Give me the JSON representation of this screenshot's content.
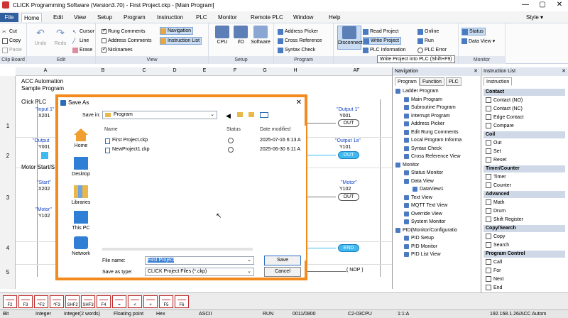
{
  "window": {
    "title": "CLICK Programming Software (Version3.70) - First Project.ckp - [Main Program]",
    "minimize": "—",
    "maximize": "▢",
    "close": "✕"
  },
  "menu": {
    "items": [
      "File",
      "Home",
      "Edit",
      "View",
      "Setup",
      "Program",
      "Instruction",
      "PLC",
      "Monitor",
      "Remote PLC",
      "Window",
      "Help"
    ],
    "style": "Style ▾"
  },
  "ribbon": {
    "clipboard": {
      "cut": "Cut",
      "copy": "Copy",
      "paste": "Paste",
      "label": "Clip Board"
    },
    "edit": {
      "undo": "Undo",
      "redo": "Redo",
      "cursor": "Cursor",
      "line": "Line",
      "erase": "Erase",
      "label": "Edit"
    },
    "view": {
      "rung_comments": "Rung Comments",
      "address_comments": "Address Comments",
      "nicknames": "Nicknames",
      "navigation": "Navigation",
      "instruction_list": "Instruction List",
      "label": "View"
    },
    "setup": {
      "cpu": "CPU",
      "io": "I/O",
      "software": "Software",
      "label": "Setup"
    },
    "program": {
      "address_picker": "Address Picker",
      "cross_reference": "Cross Reference",
      "syntax_check": "Syntax Check",
      "label": "Program"
    },
    "plc": {
      "disconnect": "Disconnect",
      "read_project": "Read Project",
      "write_project": "Write Project",
      "plc_information": "PLC Information",
      "online": "Online",
      "run": "Run",
      "plc_error": "PLC Error",
      "label": "PLC"
    },
    "monitor": {
      "status": "Status",
      "data_view": "Data View ▾",
      "label": "Monitor"
    }
  },
  "tooltip": "Write Project into PLC (Shift+F9)",
  "ladder": {
    "columns": [
      "A",
      "B",
      "C",
      "D",
      "E",
      "F",
      "G",
      "H",
      "AF"
    ],
    "rows": [
      "1",
      "2",
      "3",
      "4",
      "5"
    ],
    "comments": [
      "ACC Automation",
      "Sample Program",
      "Click PLC",
      "Motor Start/S"
    ],
    "contacts": [
      {
        "name": "\"Input 1\"",
        "addr": "X201"
      },
      {
        "name": "\"Output",
        "addr": "Y001"
      },
      {
        "name": "\"Start\"",
        "addr": "X202"
      },
      {
        "name": "\"Motor\"",
        "addr": "Y102"
      }
    ],
    "coils": [
      {
        "name": "\"Output 1\"",
        "addr": "Y001",
        "label": "OUT"
      },
      {
        "name": "\"Output 1a\"",
        "addr": "Y101",
        "label": "OUT"
      },
      {
        "name": "\"Motor\"",
        "addr": "Y102",
        "label": "OUT"
      }
    ],
    "end": "END",
    "nop": "NOP"
  },
  "dialog": {
    "title": "Save As",
    "save_in_label": "Save in:",
    "save_in_value": "Program",
    "nav": [
      "Home",
      "Desktop",
      "Libraries",
      "This PC",
      "Network"
    ],
    "headers": {
      "name": "Name",
      "status": "Status",
      "date": "Date modified"
    },
    "files": [
      {
        "name": "First Project.ckp",
        "date": "2025-07-16 6:13 A"
      },
      {
        "name": "NewProject1.ckp",
        "date": "2025-06-30 6:11 A"
      }
    ],
    "file_name_label": "File name:",
    "file_name_value": "First Project",
    "save_type_label": "Save as type:",
    "save_type_value": "CLICK Project Files (*.ckp)",
    "save_button": "Save",
    "cancel_button": "Cancel"
  },
  "navigation": {
    "title": "Navigation",
    "tabs": [
      "Program",
      "Function",
      "PLC"
    ],
    "tree": [
      "Ladder Program",
      "Main Program",
      "Subroutine Program",
      "Interrupt Program",
      "Address Picker",
      "Edit Rung Comments",
      "Local Program Informa",
      "Syntax Check",
      "Cross Reference View",
      "Monitor",
      "Status Monitor",
      "Data View",
      "DataView1",
      "Text View",
      "MQTT Text View",
      "Override View",
      "System Monitor",
      "PID(Monitor/Configuratio",
      "PID Setup",
      "PID Monitor",
      "PID List View"
    ]
  },
  "instruction_list": {
    "title": "Instruction List",
    "tab": "Instruction",
    "sections": [
      {
        "name": "Contact",
        "items": [
          "Contact (NO)",
          "Contact (NC)",
          "Edge Contact",
          "Compare"
        ]
      },
      {
        "name": "Coil",
        "items": [
          "Out",
          "Set",
          "Reset"
        ]
      },
      {
        "name": "Timer/Counter",
        "items": [
          "Timer",
          "Counter"
        ]
      },
      {
        "name": "Advanced",
        "items": [
          "Math",
          "Drum",
          "Shift Register"
        ]
      },
      {
        "name": "Copy/Search",
        "items": [
          "Copy",
          "Search"
        ]
      },
      {
        "name": "Program Control",
        "items": [
          "Call",
          "For",
          "Next",
          "End"
        ]
      }
    ]
  },
  "fkeys": [
    "F2",
    "F3",
    "^F2",
    "^F3",
    "SHF2",
    "SHF3",
    "F4",
    "=",
    "<",
    "+",
    "F5",
    "F6"
  ],
  "status": [
    "Bit",
    "Integer",
    "Integer(2 words)",
    "Floating point",
    "Hex",
    "ASCII",
    "RUN",
    "0011/0800",
    "C2-03CPU",
    "1:1:A",
    "192.168.1.26/ACC Autom"
  ]
}
